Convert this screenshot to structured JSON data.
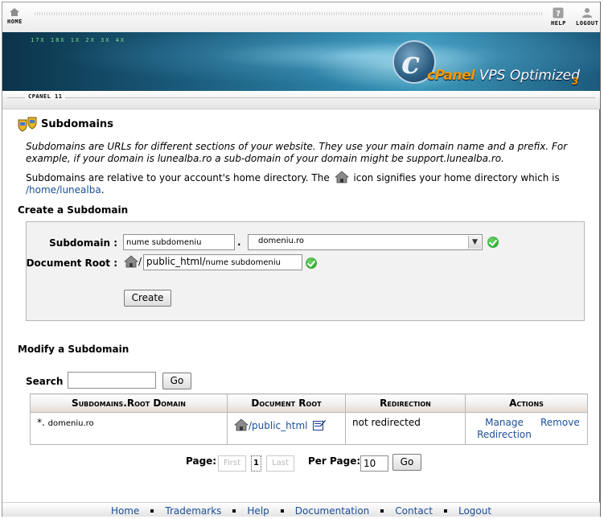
{
  "topnav": {
    "home": "HOME",
    "help": "HELP",
    "logout": "LOGOUT"
  },
  "banner": {
    "ticker": "17X  18X  1X  2X  3X  4X",
    "brand": "cPanel",
    "tagline": " VPS Optimized",
    "version": "3"
  },
  "version_label": "CPANEL 11",
  "page": {
    "title": "Subdomains",
    "desc1": "Subdomains are URLs for different sections of your website. They use your main domain name and a prefix. For example, if your domain is lunealba.ro a sub-domain of your domain might be support.lunealba.ro.",
    "desc2_a": "Subdomains are relative to your account's home directory. The",
    "desc2_b": "icon signifies your home directory which is",
    "home_dir": "/home/lunealba",
    "desc2_end": "."
  },
  "create": {
    "heading": "Create a Subdomain",
    "subdomain_label": "Subdomain :",
    "subdomain_value": "nume subdomeniu",
    "dot": ".",
    "domain_value": "domeniu.ro",
    "docroot_label": "Document Root :",
    "docroot_prefix": "/",
    "docroot_value": "public_html/",
    "docroot_suffix": "nume subdomeniu",
    "create_button": "Create"
  },
  "modify": {
    "heading": "Modify a Subdomain",
    "search_label": "Search",
    "search_value": "",
    "go_button": "Go",
    "columns": [
      "Subdomains.Root Domain",
      "Document Root",
      "Redirection",
      "Actions"
    ],
    "row": {
      "subdomain": "*.",
      "domain": "domeniu.ro",
      "docroot": "/public_html",
      "redirection": "not redirected",
      "manage_label": "Manage Redirection",
      "remove_label": "Remove"
    }
  },
  "pagination": {
    "page_label": "Page:",
    "first": "First",
    "current": "1",
    "last": "Last",
    "per_page_label": "Per Page:",
    "per_page_value": "10",
    "go_button": "Go"
  },
  "footer": {
    "links": [
      "Home",
      "Trademarks",
      "Help",
      "Documentation",
      "Contact",
      "Logout"
    ]
  }
}
